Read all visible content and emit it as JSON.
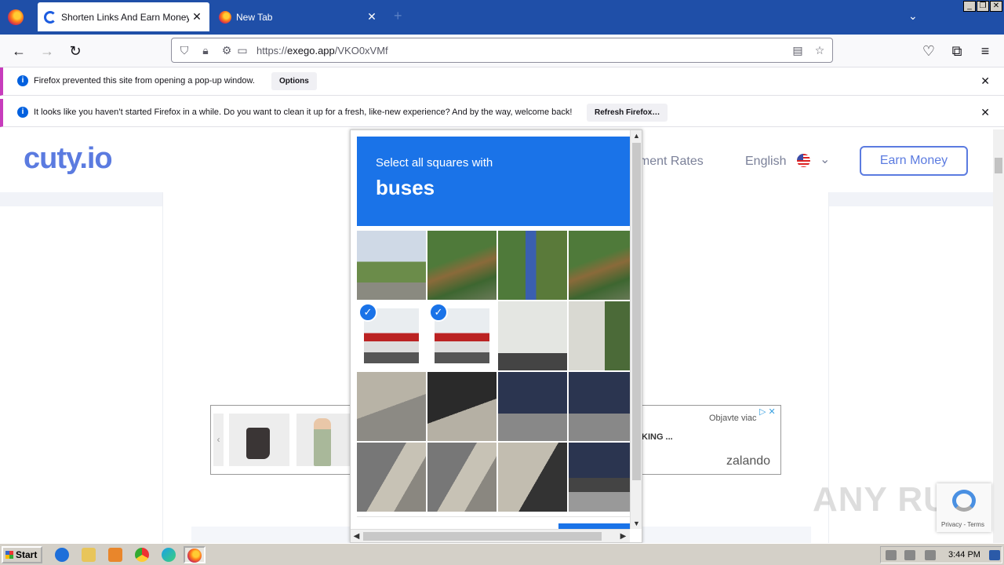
{
  "browser": {
    "tabs": [
      {
        "title": "Shorten Links And Earn Money | cu",
        "active": true
      },
      {
        "title": "New Tab",
        "active": false
      }
    ],
    "url_prefix": "https://",
    "url_host": "exego.app",
    "url_path": "/VKO0xVMf",
    "window_buttons": [
      "_",
      "❐",
      "✕"
    ]
  },
  "notifications": [
    {
      "text": "Firefox prevented this site from opening a pop-up window.",
      "button": "Options"
    },
    {
      "text": "It looks like you haven’t started Firefox in a while. Do you want to clean it up for a fresh, like-new experience? And by the way, welcome back!",
      "button": "Refresh Firefox…"
    }
  ],
  "site": {
    "logo": "cuty.io",
    "nav_payment": "ayment Rates",
    "language": "English",
    "earn_button": "Earn Money"
  },
  "ad": {
    "sponsor": "Objavte viac",
    "headline": "KING ...",
    "brand": "zalando"
  },
  "captcha": {
    "prompt": "Select all squares with",
    "target": "buses",
    "tiles": [
      {
        "row": 0,
        "col": 0,
        "scene": "sky-pole",
        "selected": false
      },
      {
        "row": 0,
        "col": 1,
        "scene": "trees",
        "selected": false
      },
      {
        "row": 0,
        "col": 2,
        "scene": "trees-sign",
        "selected": false
      },
      {
        "row": 0,
        "col": 3,
        "scene": "trees",
        "selected": false
      },
      {
        "row": 1,
        "col": 0,
        "scene": "bus-red",
        "selected": true
      },
      {
        "row": 1,
        "col": 1,
        "scene": "bus-red",
        "selected": true
      },
      {
        "row": 1,
        "col": 2,
        "scene": "bus-white",
        "selected": false
      },
      {
        "row": 1,
        "col": 3,
        "scene": "bus-white-rear",
        "selected": false
      },
      {
        "row": 2,
        "col": 0,
        "scene": "barrier",
        "selected": false
      },
      {
        "row": 2,
        "col": 1,
        "scene": "car-barrier",
        "selected": false
      },
      {
        "row": 2,
        "col": 2,
        "scene": "car",
        "selected": false
      },
      {
        "row": 2,
        "col": 3,
        "scene": "car",
        "selected": false
      },
      {
        "row": 3,
        "col": 0,
        "scene": "road-barrier",
        "selected": false
      },
      {
        "row": 3,
        "col": 1,
        "scene": "road-barrier",
        "selected": false
      },
      {
        "row": 3,
        "col": 2,
        "scene": "barrier-wheel",
        "selected": false
      },
      {
        "row": 3,
        "col": 3,
        "scene": "car-wheel",
        "selected": false
      }
    ]
  },
  "watermark": "ANY RUN",
  "recaptcha_badge": "Privacy - Terms",
  "taskbar": {
    "start": "Start",
    "clock": "3:44 PM"
  }
}
